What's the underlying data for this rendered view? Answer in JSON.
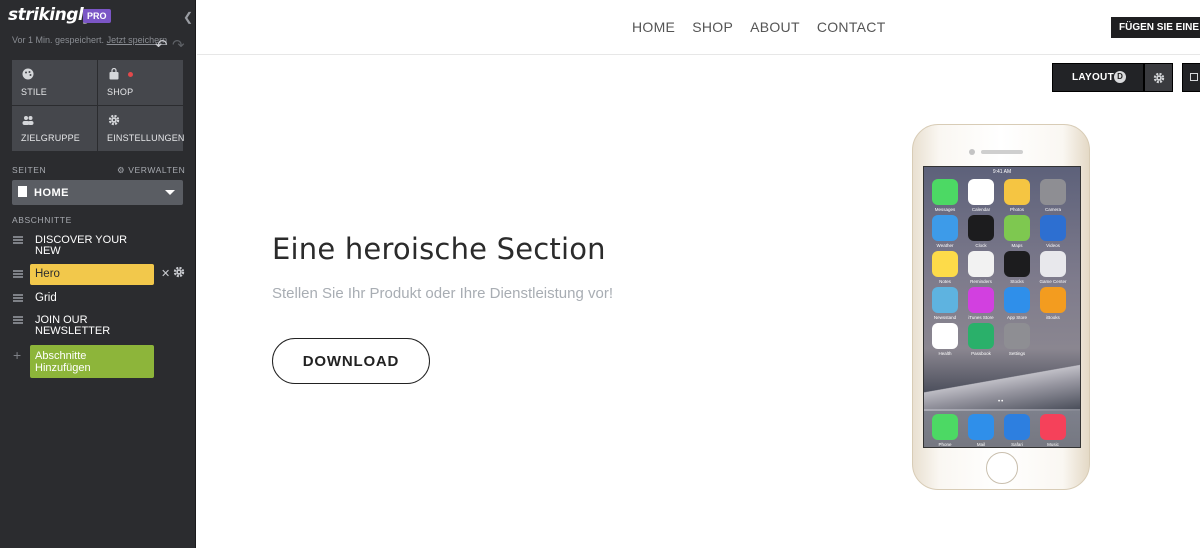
{
  "sidebar": {
    "logo": "strikingly",
    "badge": "PRO",
    "saved_status": "Vor 1 Min. gespeichert.",
    "save_now_link": "Jetzt speichern",
    "tiles": [
      {
        "label": "STILE",
        "icon": "palette-icon"
      },
      {
        "label": "SHOP",
        "icon": "shopping-bag-icon"
      },
      {
        "label": "ZIELGRUPPE",
        "icon": "people-icon"
      },
      {
        "label": "EINSTELLUNGEN",
        "icon": "gear-icon"
      }
    ],
    "pages_label": "SEITEN",
    "manage_label": "VERWALTEN",
    "current_page": "HOME",
    "sections_label": "ABSCHNITTE",
    "sections": [
      {
        "label": "DISCOVER YOUR NEW"
      },
      {
        "label": "Hero"
      },
      {
        "label": "Grid"
      },
      {
        "label": "JOIN OUR NEWSLETTER"
      }
    ],
    "add_section": "Abschnitte Hinzufügen",
    "colors": {
      "bg": "#2b2c2f",
      "hero": "#f2c84b",
      "add": "#8db53a",
      "pro": "#7b56c6"
    }
  },
  "nav": {
    "links": [
      "HOME",
      "SHOP",
      "ABOUT",
      "CONTACT"
    ],
    "cta": "FÜGEN SIE EINE"
  },
  "toolbar": {
    "layout_label": "LAYOUT",
    "layout_badge": "D"
  },
  "hero": {
    "title": "Eine heroische Section",
    "subtitle": "Stellen Sie Ihr Produkt oder Ihre Dienstleistung vor!",
    "button": "DOWNLOAD"
  },
  "phone": {
    "time": "9:41 AM",
    "apps": [
      {
        "label": "Messages",
        "color": "#4cd964"
      },
      {
        "label": "Calendar",
        "color": "#ffffff"
      },
      {
        "label": "Photos",
        "color": "#f5c542"
      },
      {
        "label": "Camera",
        "color": "#8e8e93"
      },
      {
        "label": "Weather",
        "color": "#3d9be9"
      },
      {
        "label": "Clock",
        "color": "#1c1c1e"
      },
      {
        "label": "Maps",
        "color": "#7ec850"
      },
      {
        "label": "Videos",
        "color": "#2d6fd1"
      },
      {
        "label": "Notes",
        "color": "#fddb49"
      },
      {
        "label": "Reminders",
        "color": "#f2f2f2"
      },
      {
        "label": "Stocks",
        "color": "#1c1c1e"
      },
      {
        "label": "Game Center",
        "color": "#e8e8ec"
      },
      {
        "label": "Newsstand",
        "color": "#5eb3e0"
      },
      {
        "label": "iTunes Store",
        "color": "#d240e0"
      },
      {
        "label": "App Store",
        "color": "#2f8fea"
      },
      {
        "label": "iBooks",
        "color": "#f39c1f"
      },
      {
        "label": "Health",
        "color": "#ffffff"
      },
      {
        "label": "Passbook",
        "color": "#2ab06a"
      },
      {
        "label": "Settings",
        "color": "#8e8e93"
      }
    ],
    "dock": [
      {
        "label": "Phone",
        "color": "#4cd964"
      },
      {
        "label": "Mail",
        "color": "#2f8fea"
      },
      {
        "label": "Safari",
        "color": "#2d7fe0"
      },
      {
        "label": "Music",
        "color": "#f5415a"
      }
    ]
  }
}
